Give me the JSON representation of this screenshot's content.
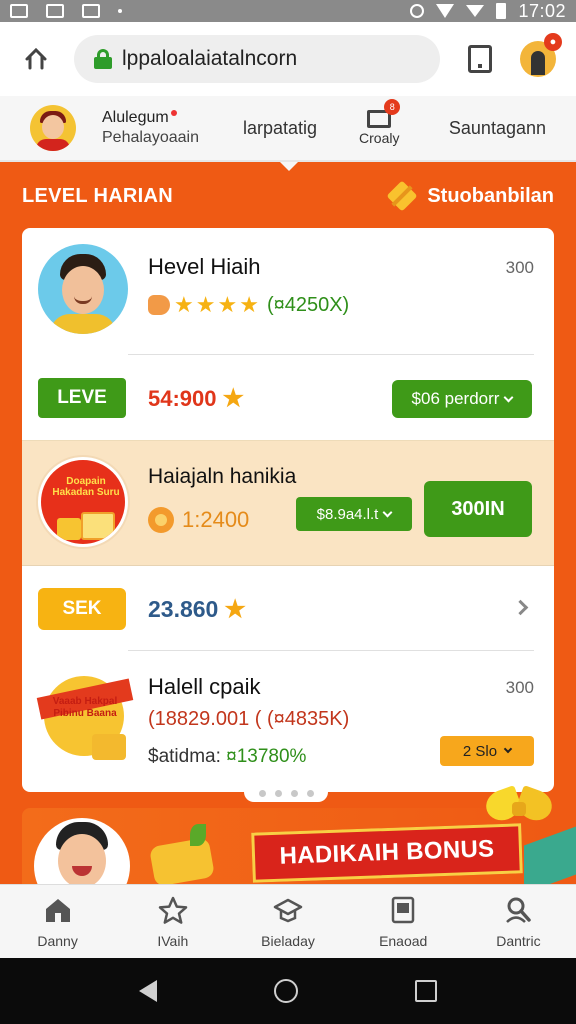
{
  "status_bar": {
    "time": "17:02"
  },
  "browser": {
    "url": "lppaloalaiatalncorn"
  },
  "top_nav": {
    "user_name": "Alulegum",
    "user_sub": "Pehalayoaain",
    "middle_link": "larpatatig",
    "cart_label": "Croaly",
    "cart_badge": "8",
    "right_link": "Sauntagann"
  },
  "level_header": {
    "title": "LEVEL HARIAN",
    "right_label": "Stuobanbilan"
  },
  "rows": {
    "row1": {
      "name": "Hevel Hiaih",
      "side_number": "300",
      "rating_text": "(¤4250X)",
      "stars": 4
    },
    "row2": {
      "badge": "LEVE",
      "value": "54:900",
      "dropdown": "$06 perdorr"
    },
    "row3": {
      "badge_text": "Doapain Hakadan Suru",
      "title": "Haiajaln hanikia",
      "amount": "1:2400",
      "dropdown": "$8.9a4.l.t",
      "button": "300IN"
    },
    "row4": {
      "badge": "SEK",
      "value": "23.860"
    },
    "row5": {
      "badge_text": "Vaaab Hakpal Pibinu Baana",
      "title": "Halell cpaik",
      "side_number": "300",
      "subtitle": "(18829.001 ( (¤4835K)",
      "line_label": "$atidma:",
      "line_value": "¤13780%",
      "dropdown": "2 Slo"
    }
  },
  "banner": {
    "label": "HADIKAIH BONUS"
  },
  "tab_bar": [
    {
      "label": "Danny",
      "icon": "home-icon"
    },
    {
      "label": "IVaih",
      "icon": "star-icon"
    },
    {
      "label": "Bieladay",
      "icon": "graduation-icon"
    },
    {
      "label": "Enaoad",
      "icon": "document-icon"
    },
    {
      "label": "Dantric",
      "icon": "search-person-icon"
    }
  ],
  "colors": {
    "brand_orange": "#ef5a14",
    "green": "#3f9a18",
    "yellow": "#f7b312",
    "red": "#e0361a"
  }
}
